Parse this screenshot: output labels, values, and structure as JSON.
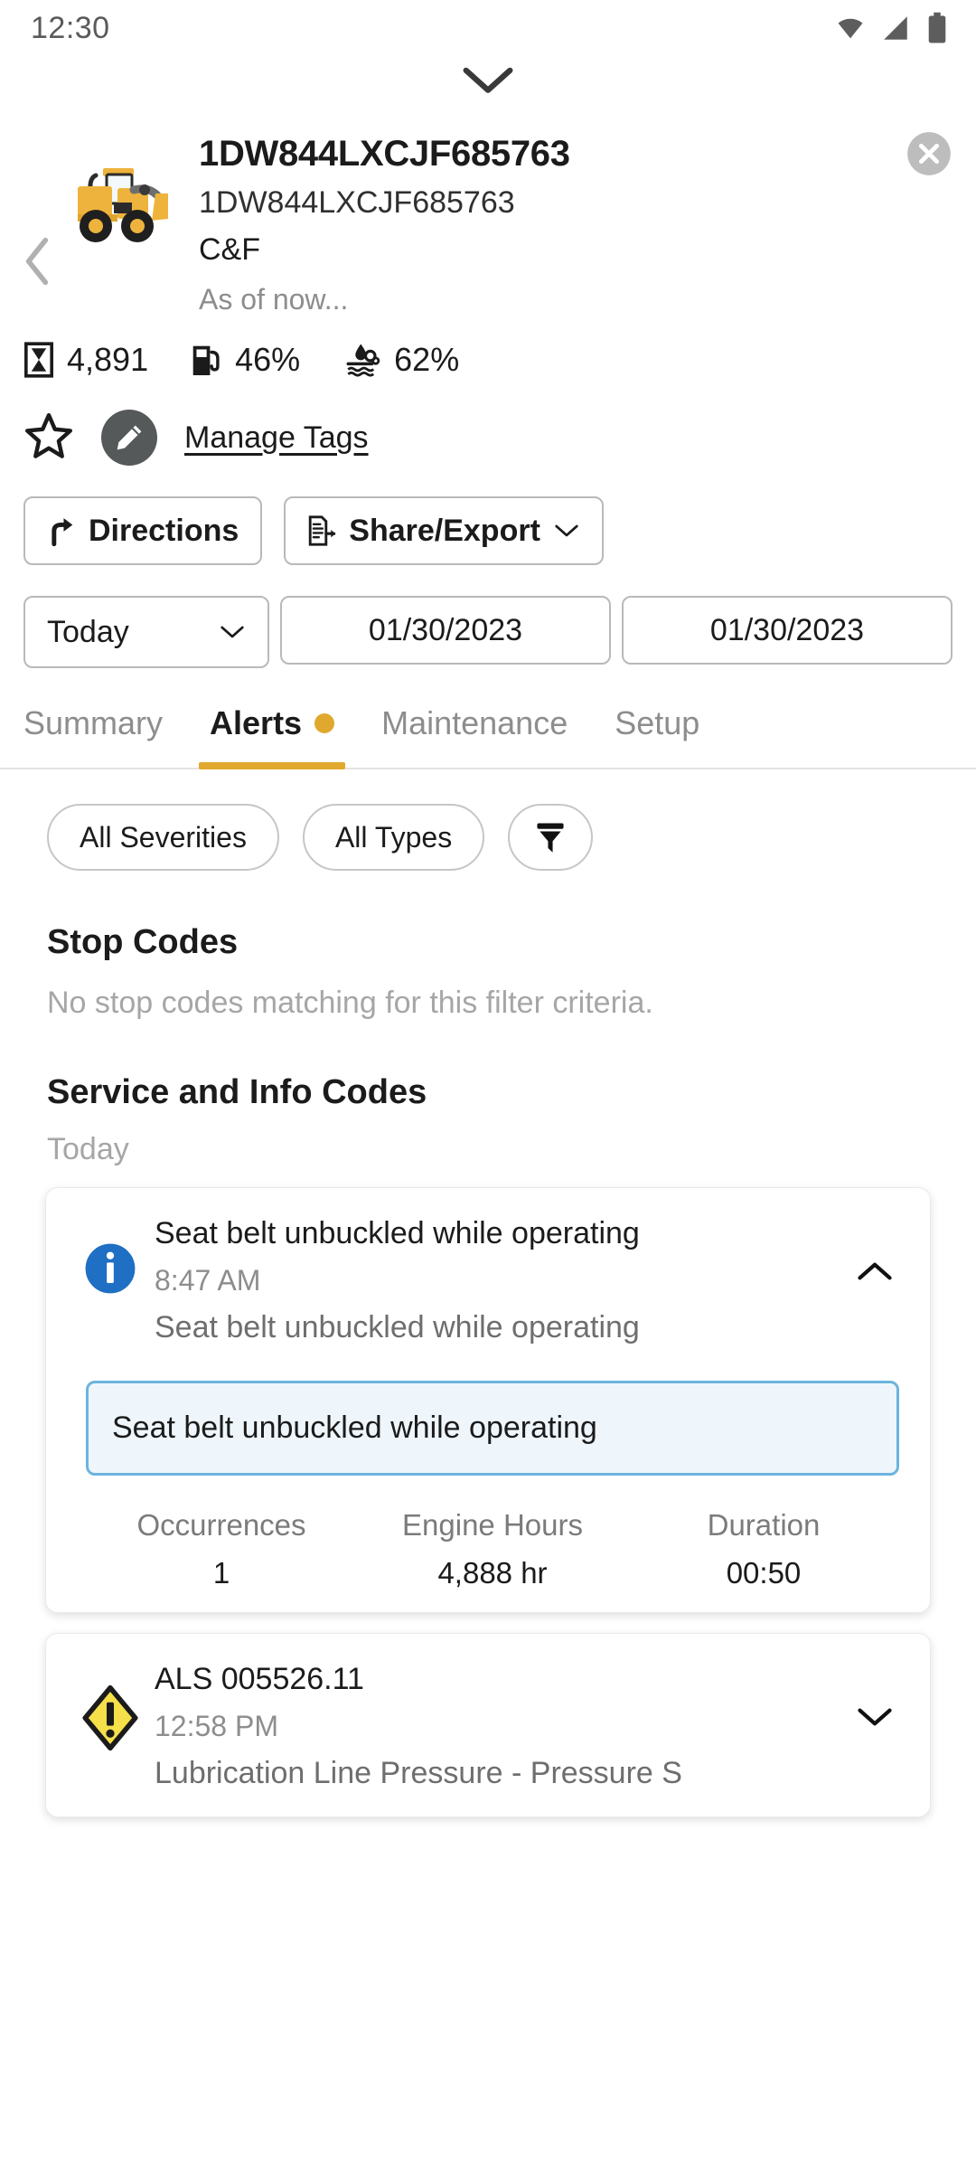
{
  "status_bar": {
    "time": "12:30",
    "icons": [
      "wifi-icon",
      "cellular-signal-icon",
      "battery-icon"
    ]
  },
  "sheet": {
    "drag_handle": "chevron-down-handle"
  },
  "header": {
    "back_label": "Back",
    "machine_icon": "wheel-loader-icon",
    "title": "1DW844LXCJF685763",
    "serial": "1DW844LXCJF685763",
    "owner": "C&F",
    "as_of": "As of now...",
    "close_label": "Close"
  },
  "metrics": [
    {
      "icon": "hour-meter-icon",
      "value": "4,891"
    },
    {
      "icon": "fuel-pump-icon",
      "value": "46%"
    },
    {
      "icon": "def-fluid-icon",
      "value": "62%"
    }
  ],
  "tags_row": {
    "favorite_icon": "star-outline-icon",
    "edit_icon": "pencil-icon",
    "manage_tags_label": "Manage Tags"
  },
  "actions": {
    "directions_label": "Directions",
    "directions_icon": "directions-arrow-icon",
    "share_label": "Share/Export",
    "share_icon": "share-document-icon",
    "share_chevron": "chevron-down-icon"
  },
  "date_range": {
    "preset_value": "Today",
    "preset_chevron": "chevron-down-icon",
    "start_date": "01/30/2023",
    "end_date": "01/30/2023"
  },
  "tabs": [
    {
      "label": "Summary",
      "active": false,
      "badge": false
    },
    {
      "label": "Alerts",
      "active": true,
      "badge": true
    },
    {
      "label": "Maintenance",
      "active": false,
      "badge": false
    },
    {
      "label": "Setup",
      "active": false,
      "badge": false
    }
  ],
  "filters": {
    "severity_label": "All Severities",
    "type_label": "All Types",
    "filter_icon": "funnel-filter-icon"
  },
  "stop_codes": {
    "title": "Stop Codes",
    "empty_message": "No stop codes matching for this filter criteria."
  },
  "service_info_codes": {
    "title": "Service and Info Codes",
    "group_label": "Today",
    "cards": [
      {
        "icon": "info-circle-icon",
        "severity_color": "#1f6fc4",
        "title": "Seat belt unbuckled while operating",
        "time": "8:47 AM",
        "description": "Seat belt unbuckled while operating",
        "expanded": true,
        "chevron": "chevron-up-icon",
        "detail_text": "Seat belt unbuckled while operating",
        "stats": [
          {
            "label": "Occurrences",
            "value": "1"
          },
          {
            "label": "Engine Hours",
            "value": "4,888 hr"
          },
          {
            "label": "Duration",
            "value": "00:50"
          }
        ]
      },
      {
        "icon": "warning-diamond-icon",
        "severity_color": "#f5e04a",
        "title": "ALS 005526.11",
        "time": "12:58 PM",
        "description": "Lubrication Line Pressure - Pressure S",
        "expanded": false,
        "chevron": "chevron-down-icon",
        "detail_text": "",
        "stats": []
      }
    ]
  },
  "colors": {
    "accent_yellow": "#e0a92e",
    "info_blue": "#1f6fc4",
    "warning_yellow": "#f5e04a",
    "highlight_bg": "#eef6fc",
    "highlight_border": "#6cb4de"
  }
}
